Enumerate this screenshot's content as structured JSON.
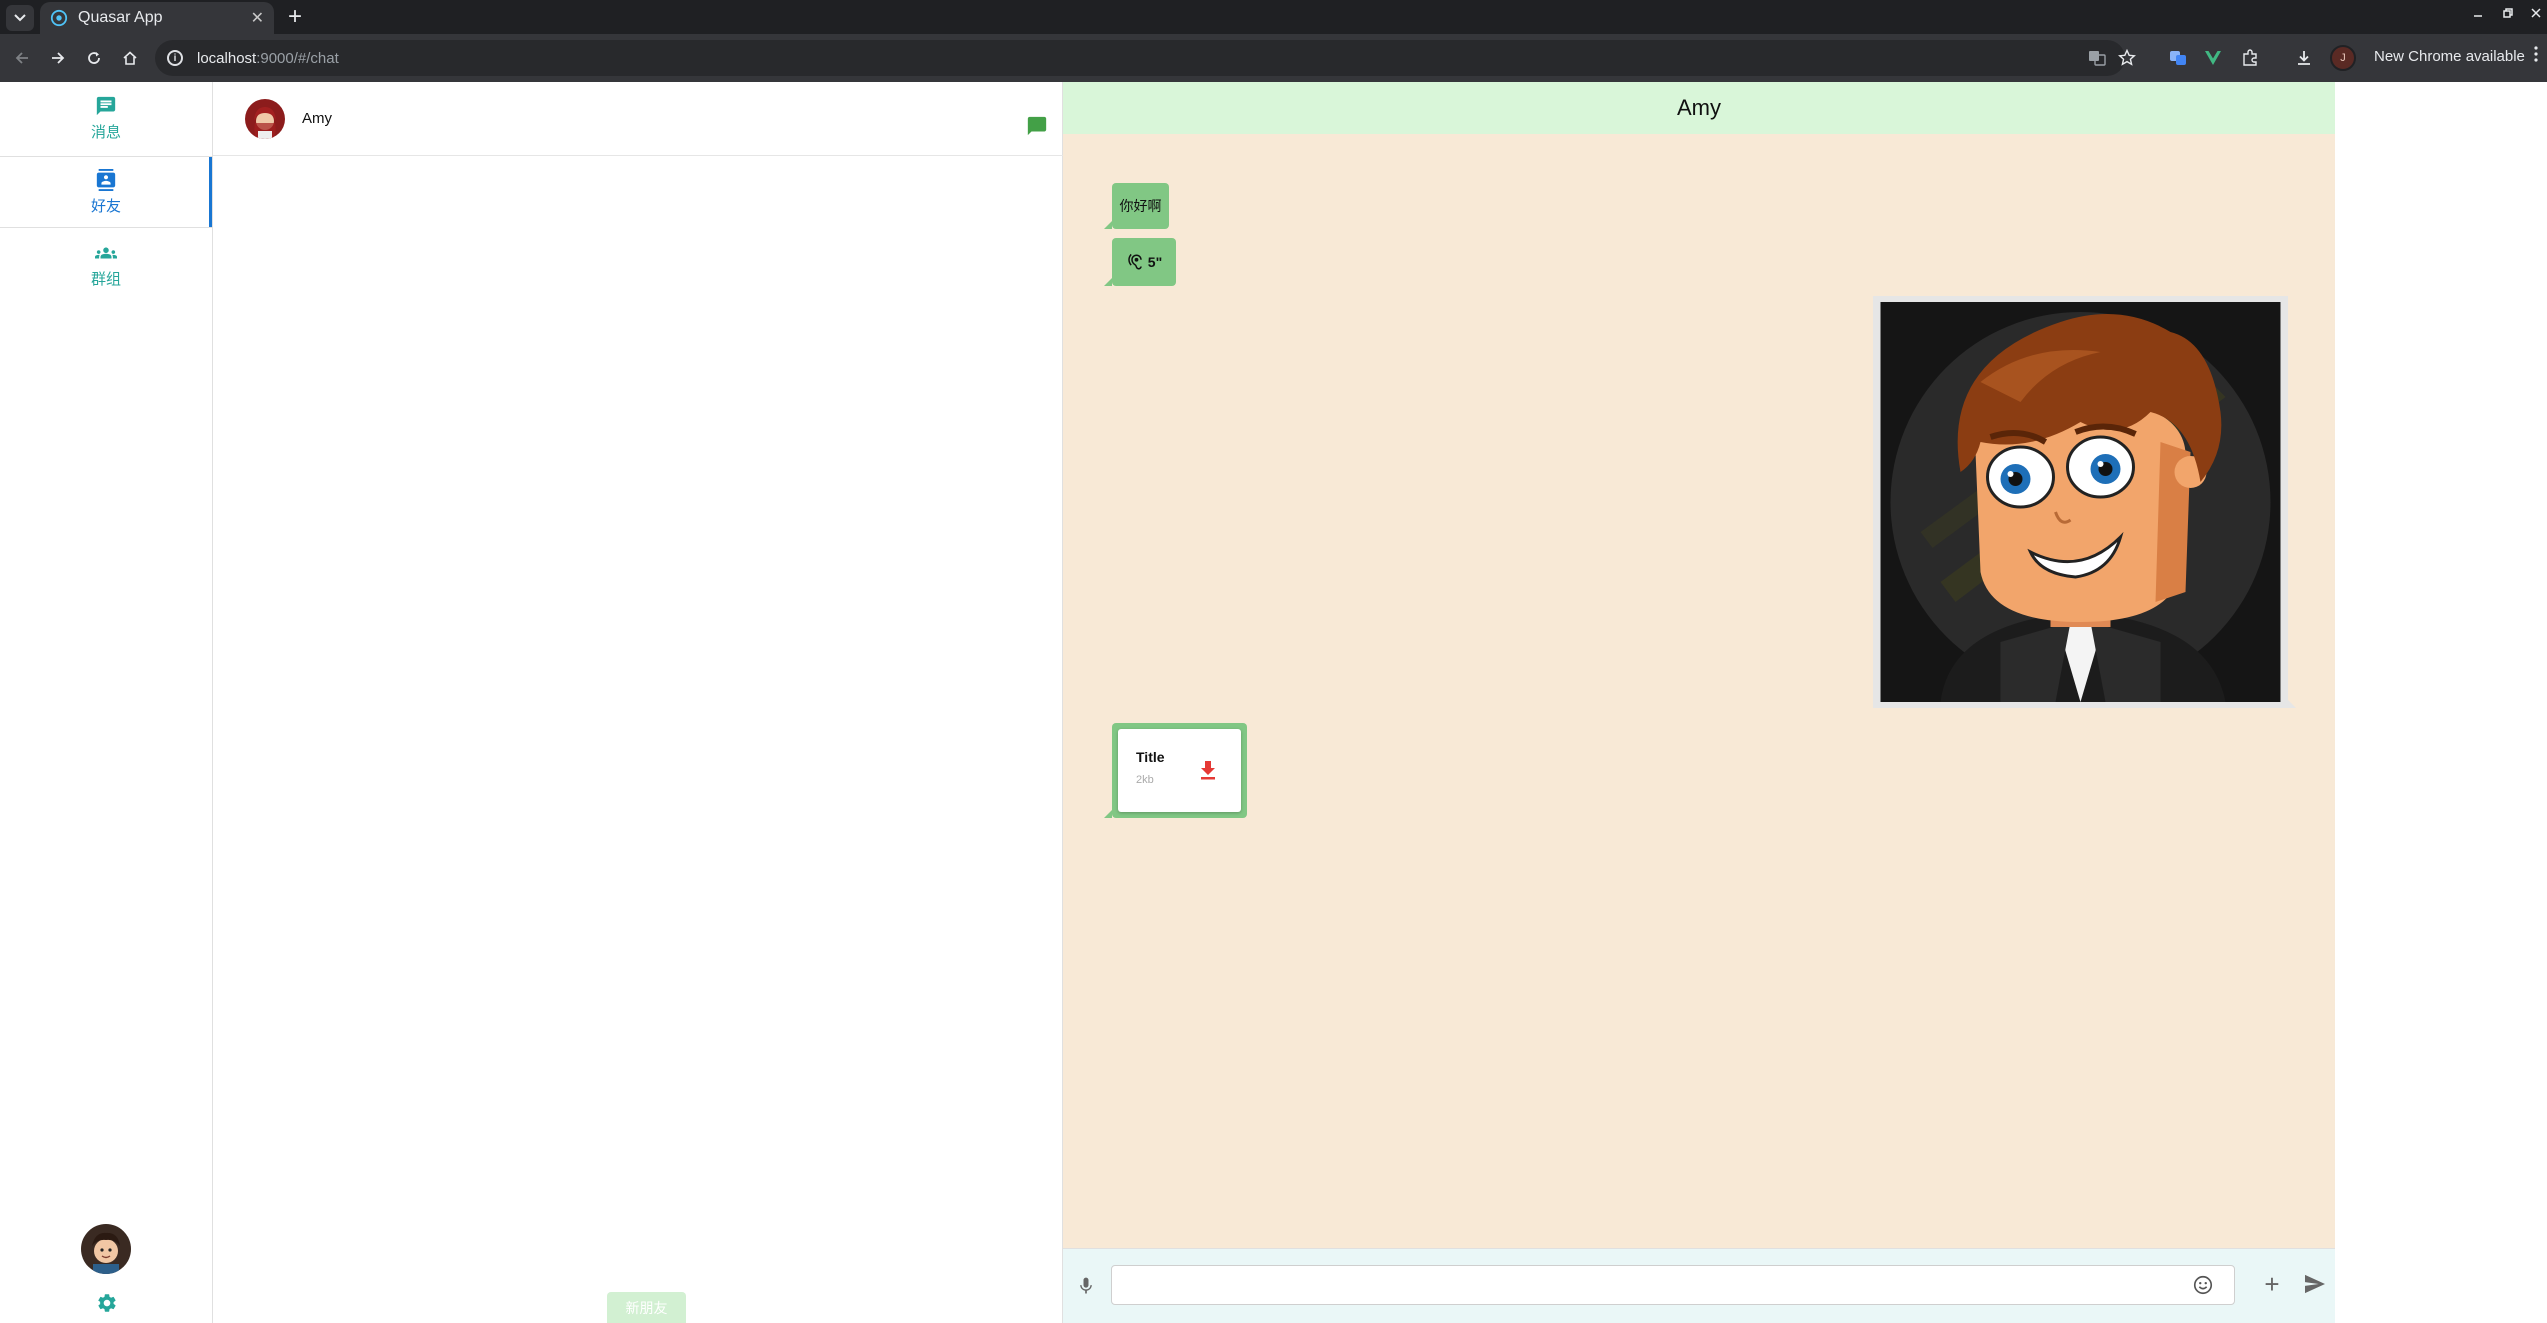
{
  "browser": {
    "tab_title": "Quasar App",
    "tab_close": "✕",
    "new_tab": "+",
    "url_host": "localhost",
    "url_path": ":9000/#/chat",
    "update_label": "New Chrome available",
    "profile_initial": "J"
  },
  "sidebar": {
    "items": [
      {
        "label": "消息",
        "icon": "chat-icon"
      },
      {
        "label": "好友",
        "icon": "contacts-icon",
        "active": true
      },
      {
        "label": "群组",
        "icon": "group-icon"
      }
    ],
    "settings_icon": "gear-icon"
  },
  "contacts": {
    "items": [
      {
        "name": "Amy",
        "icon": "message-icon"
      }
    ],
    "bottom_button": "新朋友"
  },
  "chat": {
    "title": "Amy",
    "messages": [
      {
        "type": "text",
        "text": "你好啊"
      },
      {
        "type": "voice",
        "duration": "5\""
      },
      {
        "type": "image",
        "icon": "avatar-cartoon-image"
      },
      {
        "type": "file",
        "title": "Title",
        "size": "2kb"
      }
    ],
    "input": {
      "value": "",
      "placeholder": ""
    }
  },
  "colors": {
    "accent": "#26a69a",
    "active": "#1976d2",
    "bubble": "#81c784",
    "chat_bg": "#f8e9d6",
    "header_bg": "#d9f6d9",
    "download": "#e53935"
  }
}
